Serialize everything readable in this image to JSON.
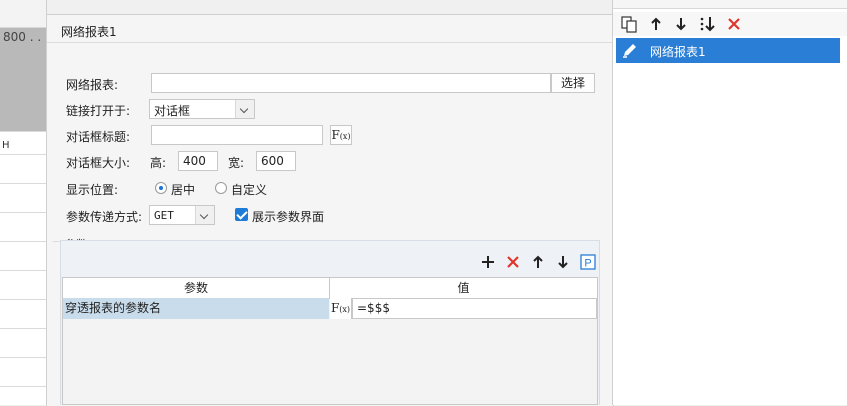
{
  "left_strip": {
    "cell_value": "800 . .",
    "column_header": "H"
  },
  "dialog": {
    "title": "网络报表1",
    "report": {
      "label": "网络报表:",
      "value": "",
      "choose_button": "选择"
    },
    "link_open": {
      "label": "链接打开于:",
      "selected": "对话框"
    },
    "dialog_title": {
      "label": "对话框标题:",
      "value": "",
      "fx_label": "F",
      "fx_sub": "(x)"
    },
    "dialog_size": {
      "label": "对话框大小:",
      "height_label": "高:",
      "height_value": "400",
      "width_label": "宽:",
      "width_value": "600"
    },
    "position": {
      "label": "显示位置:",
      "option_center": "居中",
      "option_custom": "自定义",
      "selected": "居中"
    },
    "param_pass": {
      "label": "参数传递方式:",
      "selected": "GET",
      "show_params_label": "展示参数界面",
      "show_params_checked": true
    },
    "params": {
      "group_label": "参数",
      "toolbar": [
        "add-icon",
        "delete-icon",
        "move-up-icon",
        "move-down-icon",
        "param-p-icon"
      ],
      "columns": [
        "参数",
        "值"
      ],
      "rows": [
        {
          "name": "穿透报表的参数名",
          "fx_label": "F",
          "fx_sub": "(x)",
          "value": "=$$$"
        }
      ]
    }
  },
  "right_panel": {
    "toolbar": [
      "copy-icon",
      "move-up-icon",
      "move-down-icon",
      "sort-down-icon",
      "delete-icon"
    ],
    "items": [
      {
        "label": "网络报表1",
        "selected": true,
        "icon": "pencil-icon"
      }
    ]
  },
  "colors": {
    "accent": "#2a7ed6",
    "delete": "#e0352b",
    "row_highlight": "#c9dceb"
  }
}
